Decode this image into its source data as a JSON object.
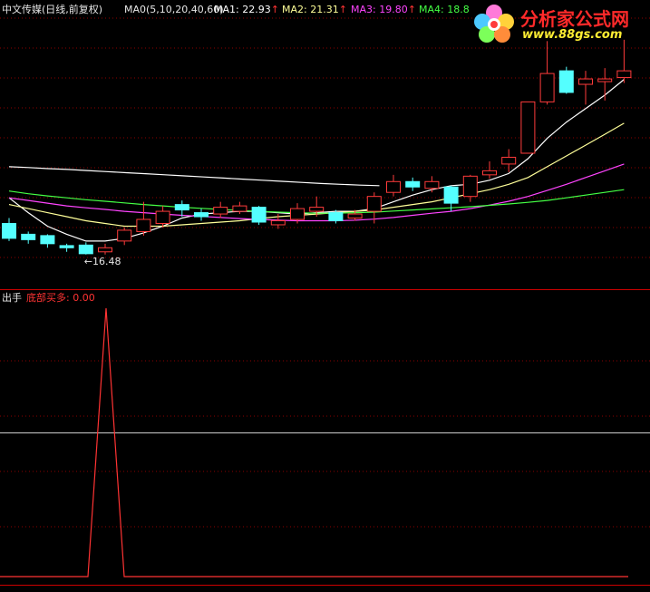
{
  "header": {
    "stock_name": "中文传媒(日线,前复权)",
    "ma_params": "MA0(5,10,20,40,60)",
    "ma1": "MA1: 22.93",
    "ma2": "MA2: 21.31",
    "ma3": "MA3: 19.80",
    "ma4": "MA4: 18.8",
    "arrow": "↑"
  },
  "logo": {
    "title": "分析家公式网",
    "url": "www.88gs.com"
  },
  "indicator": {
    "name": "出手",
    "series_label": "底部买多: 0.00"
  },
  "colors": {
    "background": "#000000",
    "up": "#ff3b3b",
    "down": "#54ffff",
    "ma1": "#ffffff",
    "ma2": "#ffff99",
    "ma3": "#ff44ff",
    "ma4": "#44ff44",
    "ma0": "#ffffff",
    "signal": "#ff3333",
    "grid": "#8b0000",
    "divider": "#cc0000"
  },
  "chart_data": [
    {
      "type": "candlestick",
      "title": "中文传媒(日线,前复权)",
      "ylim": [
        15.2,
        25.2
      ],
      "min_annotation": {
        "label": "16.48",
        "value": 16.48,
        "index": 4
      },
      "candles": [
        {
          "o": 17.6,
          "c": 17.05,
          "h": 17.8,
          "l": 16.95
        },
        {
          "o": 17.2,
          "c": 17.0,
          "h": 17.3,
          "l": 16.85
        },
        {
          "o": 17.15,
          "c": 16.85,
          "h": 17.2,
          "l": 16.7
        },
        {
          "o": 16.78,
          "c": 16.7,
          "h": 16.85,
          "l": 16.55
        },
        {
          "o": 16.8,
          "c": 16.48,
          "h": 16.9,
          "l": 16.45
        },
        {
          "o": 16.55,
          "c": 16.7,
          "h": 16.85,
          "l": 16.45
        },
        {
          "o": 16.95,
          "c": 17.35,
          "h": 17.45,
          "l": 16.8
        },
        {
          "o": 17.3,
          "c": 17.75,
          "h": 18.4,
          "l": 17.15
        },
        {
          "o": 17.6,
          "c": 18.05,
          "h": 18.25,
          "l": 17.45
        },
        {
          "o": 18.3,
          "c": 18.1,
          "h": 18.45,
          "l": 17.85
        },
        {
          "o": 18.0,
          "c": 17.85,
          "h": 18.15,
          "l": 17.7
        },
        {
          "o": 17.95,
          "c": 18.2,
          "h": 18.4,
          "l": 17.8
        },
        {
          "o": 18.05,
          "c": 18.25,
          "h": 18.4,
          "l": 17.95
        },
        {
          "o": 18.2,
          "c": 17.65,
          "h": 18.25,
          "l": 17.55
        },
        {
          "o": 17.55,
          "c": 17.7,
          "h": 17.95,
          "l": 17.4
        },
        {
          "o": 17.75,
          "c": 18.15,
          "h": 18.35,
          "l": 17.6
        },
        {
          "o": 18.05,
          "c": 18.2,
          "h": 18.6,
          "l": 17.85
        },
        {
          "o": 18.0,
          "c": 17.7,
          "h": 18.1,
          "l": 17.6
        },
        {
          "o": 17.8,
          "c": 17.95,
          "h": 18.1,
          "l": 17.7
        },
        {
          "o": 18.05,
          "c": 18.6,
          "h": 18.75,
          "l": 17.6
        },
        {
          "o": 18.75,
          "c": 19.15,
          "h": 19.4,
          "l": 18.6
        },
        {
          "o": 19.15,
          "c": 18.95,
          "h": 19.3,
          "l": 18.8
        },
        {
          "o": 18.9,
          "c": 19.15,
          "h": 19.35,
          "l": 18.75
        },
        {
          "o": 18.95,
          "c": 18.35,
          "h": 19.0,
          "l": 18.05
        },
        {
          "o": 18.6,
          "c": 19.35,
          "h": 19.4,
          "l": 18.4
        },
        {
          "o": 19.4,
          "c": 19.55,
          "h": 19.9,
          "l": 19.25
        },
        {
          "o": 19.8,
          "c": 20.05,
          "h": 20.35,
          "l": 19.5
        },
        {
          "o": 20.2,
          "c": 22.1,
          "h": 22.1,
          "l": 20.2
        },
        {
          "o": 22.1,
          "c": 23.15,
          "h": 24.35,
          "l": 22.0
        },
        {
          "o": 23.25,
          "c": 22.45,
          "h": 23.4,
          "l": 22.4
        },
        {
          "o": 22.75,
          "c": 22.95,
          "h": 23.25,
          "l": 22.0
        },
        {
          "o": 22.85,
          "c": 22.95,
          "h": 23.35,
          "l": 22.15
        },
        {
          "o": 23.0,
          "c": 23.25,
          "h": 24.4,
          "l": 22.8
        }
      ],
      "ma_lines": [
        {
          "name": "MA0",
          "color": "#ffffff",
          "from": 0,
          "values": [
            19.7,
            19.67,
            19.63,
            19.6,
            19.56,
            19.52,
            19.48,
            19.44,
            19.4,
            19.36,
            19.32,
            19.28,
            19.24,
            19.2,
            19.16,
            19.12,
            19.08,
            19.05,
            19.02,
            19.0
          ]
        },
        {
          "name": "MA1",
          "color": "#ffffff",
          "from": 0,
          "values": [
            18.55,
            18.0,
            17.5,
            17.2,
            16.95,
            16.95,
            17.05,
            17.25,
            17.5,
            17.8,
            17.95,
            18.0,
            18.05,
            18.05,
            18.0,
            17.95,
            18.0,
            18.05,
            18.05,
            18.15,
            18.4,
            18.65,
            18.85,
            19.0,
            19.05,
            19.2,
            19.45,
            20.0,
            20.75,
            21.35,
            21.85,
            22.35,
            22.93
          ]
        },
        {
          "name": "MA2",
          "color": "#ffff99",
          "from": 0,
          "values": [
            18.3,
            18.15,
            18.0,
            17.85,
            17.7,
            17.6,
            17.5,
            17.5,
            17.5,
            17.55,
            17.6,
            17.65,
            17.7,
            17.78,
            17.85,
            17.9,
            17.95,
            18.0,
            18.05,
            18.1,
            18.2,
            18.3,
            18.4,
            18.55,
            18.7,
            18.85,
            19.05,
            19.3,
            19.7,
            20.1,
            20.5,
            20.9,
            21.31
          ]
        },
        {
          "name": "MA3",
          "color": "#ff44ff",
          "from": 0,
          "values": [
            18.55,
            18.45,
            18.35,
            18.25,
            18.18,
            18.12,
            18.05,
            18.0,
            17.95,
            17.9,
            17.86,
            17.82,
            17.78,
            17.75,
            17.72,
            17.7,
            17.7,
            17.7,
            17.72,
            17.76,
            17.82,
            17.9,
            17.98,
            18.05,
            18.15,
            18.28,
            18.42,
            18.6,
            18.82,
            19.05,
            19.3,
            19.55,
            19.8
          ]
        },
        {
          "name": "MA4",
          "color": "#44ff44",
          "from": 0,
          "values": [
            18.8,
            18.7,
            18.62,
            18.55,
            18.48,
            18.42,
            18.36,
            18.3,
            18.25,
            18.2,
            18.16,
            18.12,
            18.08,
            18.05,
            18.02,
            18.0,
            17.98,
            17.98,
            18.0,
            18.02,
            18.06,
            18.1,
            18.14,
            18.18,
            18.22,
            18.27,
            18.32,
            18.38,
            18.45,
            18.55,
            18.65,
            18.75,
            18.85
          ]
        }
      ]
    },
    {
      "type": "line",
      "title": "出手",
      "series": [
        {
          "name": "底部买多",
          "values": [
            0,
            0,
            0,
            0,
            1,
            0,
            0,
            0,
            0,
            0,
            0,
            0,
            0,
            0,
            0,
            0,
            0,
            0,
            0,
            0,
            0,
            0,
            0,
            0,
            0,
            0,
            0,
            0,
            0,
            0,
            0,
            0,
            0
          ]
        }
      ],
      "ylim": [
        0,
        1
      ]
    }
  ]
}
